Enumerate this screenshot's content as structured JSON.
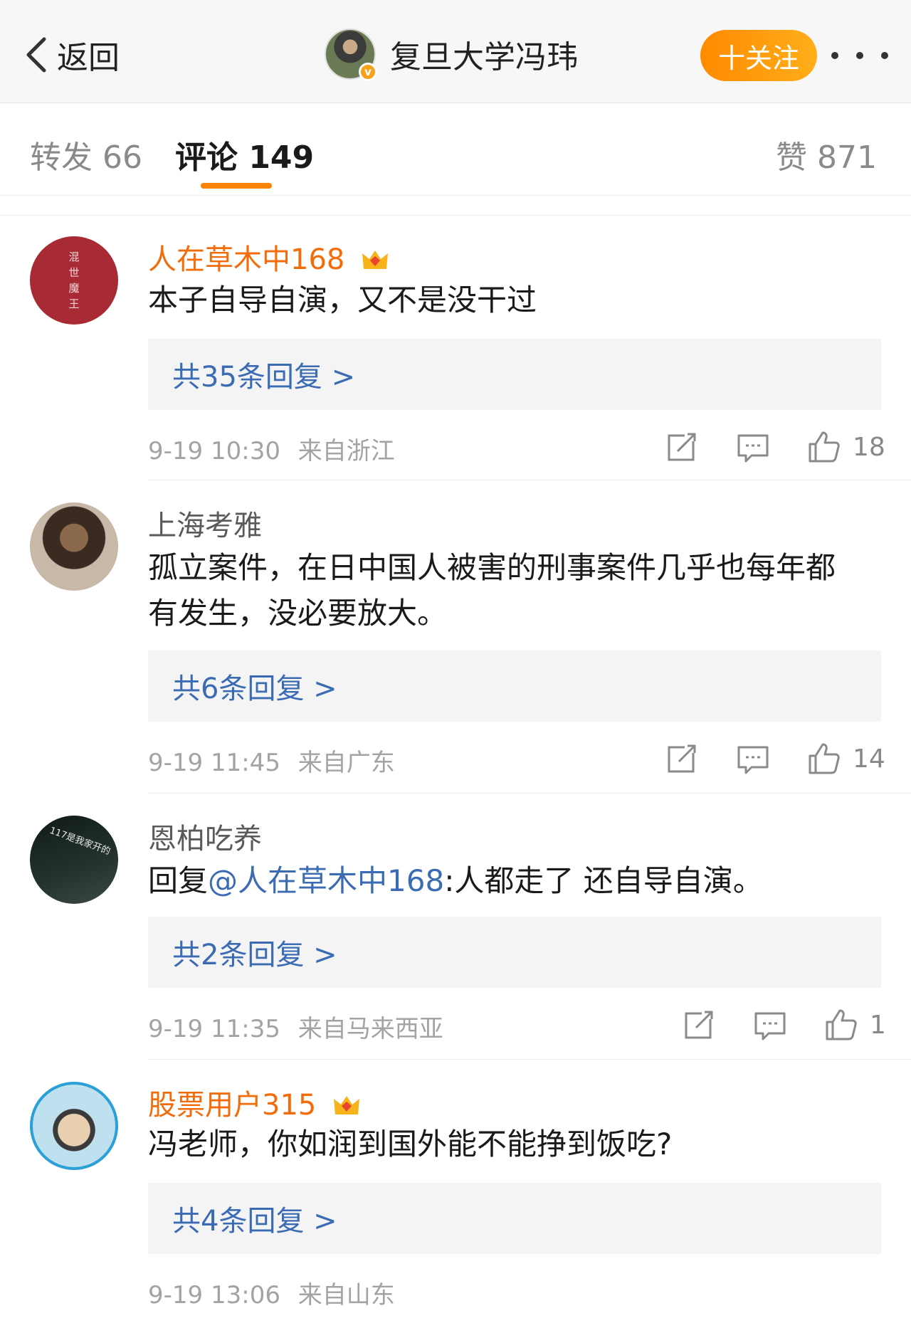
{
  "header": {
    "back_label": "返回",
    "user_name": "复旦大学冯玮",
    "verified_mark": "v",
    "follow_label": "十关注"
  },
  "tabs": {
    "repost": "转发 66",
    "comments": "评论 149",
    "likes": "赞 871"
  },
  "colors": {
    "accent": "#ff8200",
    "vip_name": "#f26d0a",
    "link": "#3b6cb3"
  },
  "comments": [
    {
      "user": "人在草木中168",
      "vip": true,
      "avatar_text": [
        "混",
        "世",
        "魔",
        "王"
      ],
      "text": "本子自导自演，又不是没干过",
      "replies": "共35条回复 >",
      "time": "9-19 10:30",
      "location": "来自浙江",
      "likes": "18"
    },
    {
      "user": "上海考雅",
      "vip": false,
      "text": "孤立案件，在日中国人被害的刑事案件几乎也每年都有发生，没必要放大。",
      "replies": "共6条回复 >",
      "time": "9-19 11:45",
      "location": "来自广东",
      "likes": "14"
    },
    {
      "user": "恩柏吃养",
      "vip": false,
      "avatar_text": "117是我家开的",
      "text_prefix": "回复",
      "mention": "@人在草木中168",
      "text_suffix": ":人都走了 还自导自演。",
      "replies": "共2条回复 >",
      "time": "9-19 11:35",
      "location": "来自马来西亚",
      "likes": "1"
    },
    {
      "user": "股票用户315",
      "vip": true,
      "text": "冯老师，你如润到国外能不能挣到饭吃?",
      "replies": "共4条回复 >",
      "time": "9-19 13:06",
      "location": "来自山东"
    }
  ],
  "icons": [
    "chevron-left-icon",
    "repost-icon",
    "comment-icon",
    "thumb-up-icon",
    "crown-icon"
  ]
}
